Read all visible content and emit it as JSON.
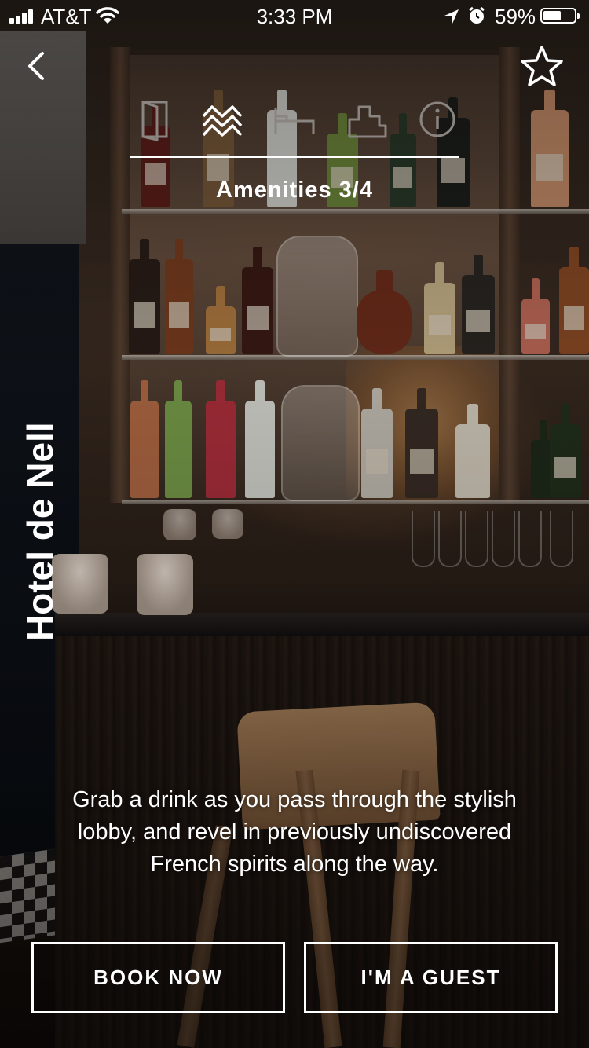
{
  "status_bar": {
    "carrier": "AT&T",
    "time": "3:33 PM",
    "battery_percent": "59%",
    "battery_level": 0.59,
    "icons": [
      "signal-icon",
      "wifi-icon",
      "location-arrow-icon",
      "alarm-icon",
      "battery-icon"
    ]
  },
  "nav": {
    "back_icon": "chevron-left-icon",
    "favorite_icon": "star-outline-icon"
  },
  "tabs": {
    "items": [
      {
        "icon": "door-icon",
        "active": false
      },
      {
        "icon": "waves-icon",
        "active": true
      },
      {
        "icon": "bed-icon",
        "active": false
      },
      {
        "icon": "city-icon",
        "active": false
      },
      {
        "icon": "info-icon",
        "active": false
      }
    ],
    "section_label": "Amenities",
    "section_counter": "3/4"
  },
  "hotel": {
    "name": "Hotel de Nell"
  },
  "description": "Grab a drink as you pass through the stylish lobby, and revel in previously undiscovered French spirits along the way.",
  "actions": {
    "book_label": "BOOK NOW",
    "guest_label": "I'M A GUEST"
  },
  "colors": {
    "text": "#ffffff",
    "active_tab": "#ffffff",
    "inactive_tab": "#8a8580"
  }
}
